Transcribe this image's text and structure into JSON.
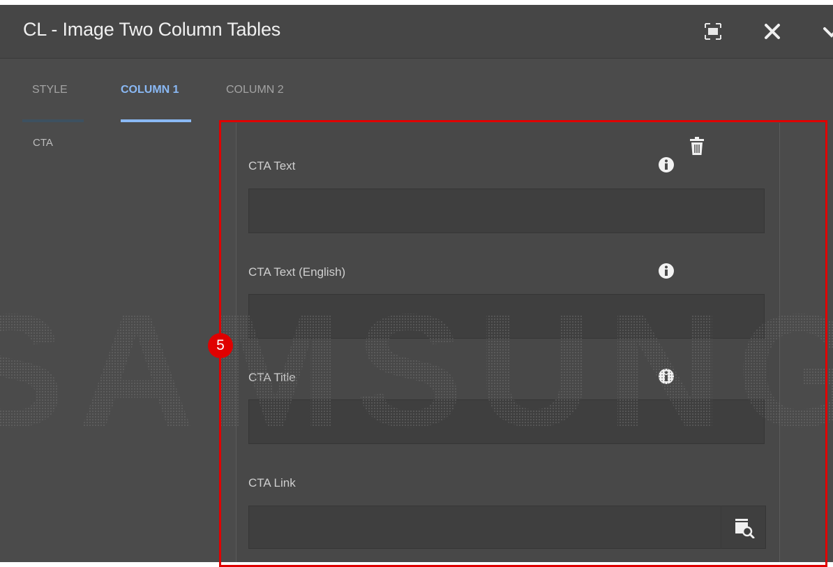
{
  "dialog": {
    "title": "CL - Image Two Column Tables",
    "controls": {
      "fullscreen": "fullscreen-icon",
      "close": "close-icon",
      "done": "chevron-icon"
    }
  },
  "tabs": [
    {
      "label": "STYLE",
      "active": false
    },
    {
      "label": "COLUMN 1",
      "active": true
    },
    {
      "label": "COLUMN 2",
      "active": false
    }
  ],
  "sidenav": {
    "items": [
      "CTA"
    ]
  },
  "fields": {
    "cta_text": {
      "label": "CTA Text",
      "value": ""
    },
    "cta_text_english": {
      "label": "CTA Text (English)",
      "value": ""
    },
    "cta_title": {
      "label": "CTA Title",
      "value": ""
    },
    "cta_link": {
      "label": "CTA Link",
      "value": ""
    }
  },
  "annotation": {
    "badge": "5",
    "color": "#e00000"
  },
  "watermark": {
    "text": "SAMSUNG"
  },
  "colors": {
    "accent": "#8ab9f5",
    "annotation": "#e00000"
  }
}
